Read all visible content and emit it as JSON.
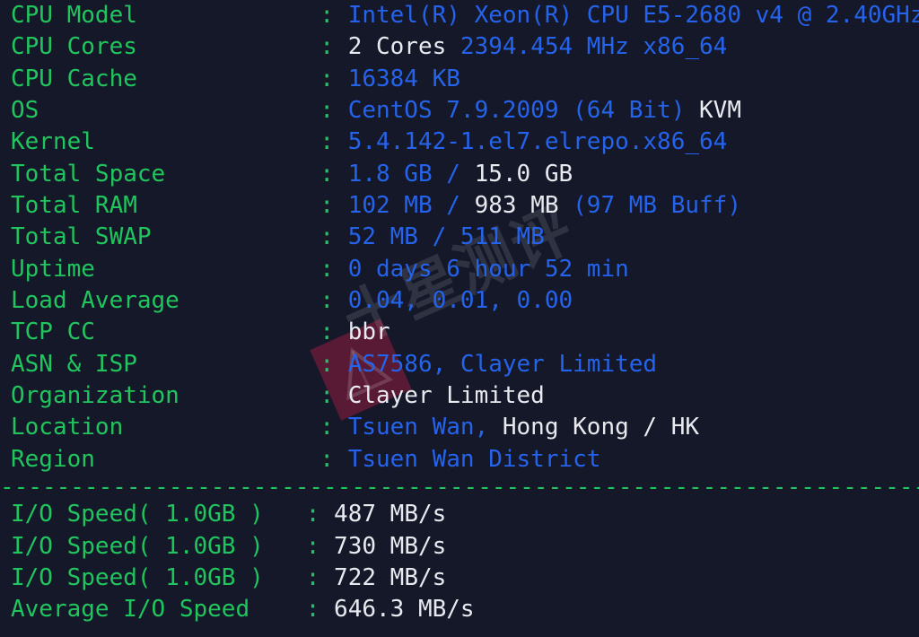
{
  "terminal": {
    "background_color": "#151829",
    "label_color": "#21c55d",
    "value_blue": "#2563eb",
    "value_white": "#e8eaf0",
    "separator": "----------------------------------------------------------------------",
    "colon": ":"
  },
  "watermark": {
    "text": "十星测评",
    "logo_color": "#be1e46"
  },
  "system_info": [
    {
      "label": "CPU Model",
      "segments": [
        {
          "text": "Intel(R) Xeon(R) CPU E5-2680 v4 @ 2.40GHz",
          "color": "blue"
        }
      ]
    },
    {
      "label": "CPU Cores",
      "segments": [
        {
          "text": "2 Cores ",
          "color": "white"
        },
        {
          "text": "2394.454 MHz x86_64",
          "color": "blue"
        }
      ]
    },
    {
      "label": "CPU Cache",
      "segments": [
        {
          "text": "16384 KB",
          "color": "blue"
        }
      ]
    },
    {
      "label": "OS",
      "segments": [
        {
          "text": "CentOS 7.9.2009 (64 Bit) ",
          "color": "blue"
        },
        {
          "text": "KVM",
          "color": "white"
        }
      ]
    },
    {
      "label": "Kernel",
      "segments": [
        {
          "text": "5.4.142-1.el7.elrepo.x86_64",
          "color": "blue"
        }
      ]
    },
    {
      "label": "Total Space",
      "segments": [
        {
          "text": "1.8 GB / ",
          "color": "blue"
        },
        {
          "text": "15.0 GB",
          "color": "white"
        }
      ]
    },
    {
      "label": "Total RAM",
      "segments": [
        {
          "text": "102 MB / ",
          "color": "blue"
        },
        {
          "text": "983 MB",
          "color": "white"
        },
        {
          "text": " (97 MB Buff)",
          "color": "blue"
        }
      ]
    },
    {
      "label": "Total SWAP",
      "segments": [
        {
          "text": "52 MB / 511 MB",
          "color": "blue"
        }
      ]
    },
    {
      "label": "Uptime",
      "segments": [
        {
          "text": "0 days 6 hour 52 min",
          "color": "blue"
        }
      ]
    },
    {
      "label": "Load Average",
      "segments": [
        {
          "text": "0.04, 0.01, 0.00",
          "color": "blue"
        }
      ]
    },
    {
      "label": "TCP CC",
      "segments": [
        {
          "text": "bbr",
          "color": "white"
        }
      ]
    },
    {
      "label": "ASN & ISP",
      "segments": [
        {
          "text": "AS7586, Clayer Limited",
          "color": "blue"
        }
      ]
    },
    {
      "label": "Organization",
      "segments": [
        {
          "text": "Clayer Limited",
          "color": "white"
        }
      ]
    },
    {
      "label": "Location",
      "segments": [
        {
          "text": "Tsuen Wan, ",
          "color": "blue"
        },
        {
          "text": "Hong Kong / HK",
          "color": "white"
        }
      ]
    },
    {
      "label": "Region",
      "segments": [
        {
          "text": "Tsuen Wan District",
          "color": "blue"
        }
      ]
    }
  ],
  "io_tests": [
    {
      "label": "I/O Speed( 1.0GB )",
      "segments": [
        {
          "text": "487 MB/s",
          "color": "white"
        }
      ]
    },
    {
      "label": "I/O Speed( 1.0GB )",
      "segments": [
        {
          "text": "730 MB/s",
          "color": "white"
        }
      ]
    },
    {
      "label": "I/O Speed( 1.0GB )",
      "segments": [
        {
          "text": "722 MB/s",
          "color": "white"
        }
      ]
    },
    {
      "label": "Average I/O Speed",
      "segments": [
        {
          "text": "646.3 MB/s",
          "color": "white"
        }
      ]
    }
  ]
}
